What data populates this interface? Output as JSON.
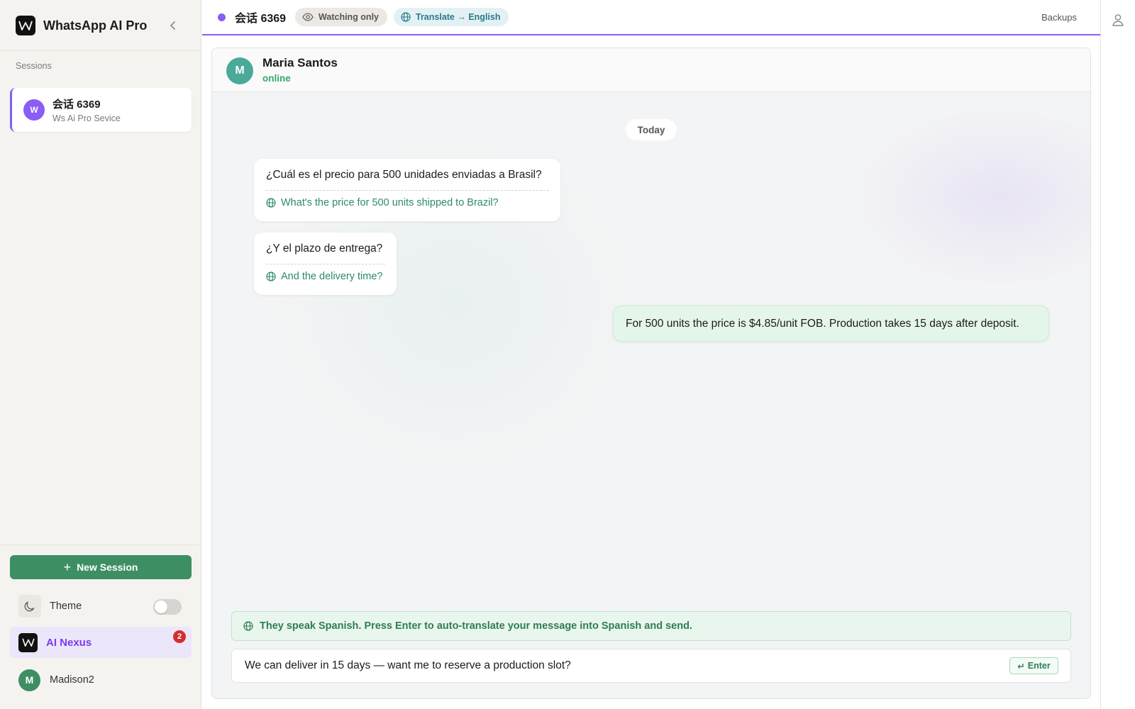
{
  "app": {
    "title": "WhatsApp AI Pro"
  },
  "sidebar": {
    "sessions_label": "Sessions",
    "session": {
      "avatar": "W",
      "title": "会话 6369",
      "subtitle": "Ws Ai Pro Sevice"
    },
    "new_session_label": "New Session",
    "theme_label": "Theme",
    "theme_dark_mode": false,
    "accounts": [
      {
        "name": "AI Nexus",
        "badge": "2",
        "active": true
      },
      {
        "name": "Madison2",
        "avatar": "M",
        "active": false
      }
    ]
  },
  "topbar": {
    "title": "会话 6369",
    "watch_label": "Watching only",
    "translate_label": "Translate → English",
    "backups_label": "Backups"
  },
  "chat": {
    "contact": {
      "avatar": "M",
      "name": "Maria Santos",
      "status": "online"
    },
    "date_label": "Today",
    "messages": [
      {
        "direction": "incoming",
        "original": "¿Cuál es el precio para 500 unidades enviadas a Brasil?",
        "translation": "What's the price for 500 units shipped to Brazil?"
      },
      {
        "direction": "incoming",
        "original": "¿Y el plazo de entrega?",
        "translation": "And the delivery time?"
      },
      {
        "direction": "outgoing",
        "text": "For 500 units the price is $4.85/unit FOB. Production takes 15 days after deposit."
      }
    ],
    "hint": "They speak Spanish. Press Enter to auto-translate your message into Spanish and send.",
    "composer_value": "We can deliver in 15 days — want me to reserve a production slot?",
    "enter_label": "Enter"
  },
  "colors": {
    "accent": "#8b5cf6",
    "primary_green": "#3d8f63",
    "online_green": "#3aa76d",
    "badge_red": "#d32f2f"
  }
}
